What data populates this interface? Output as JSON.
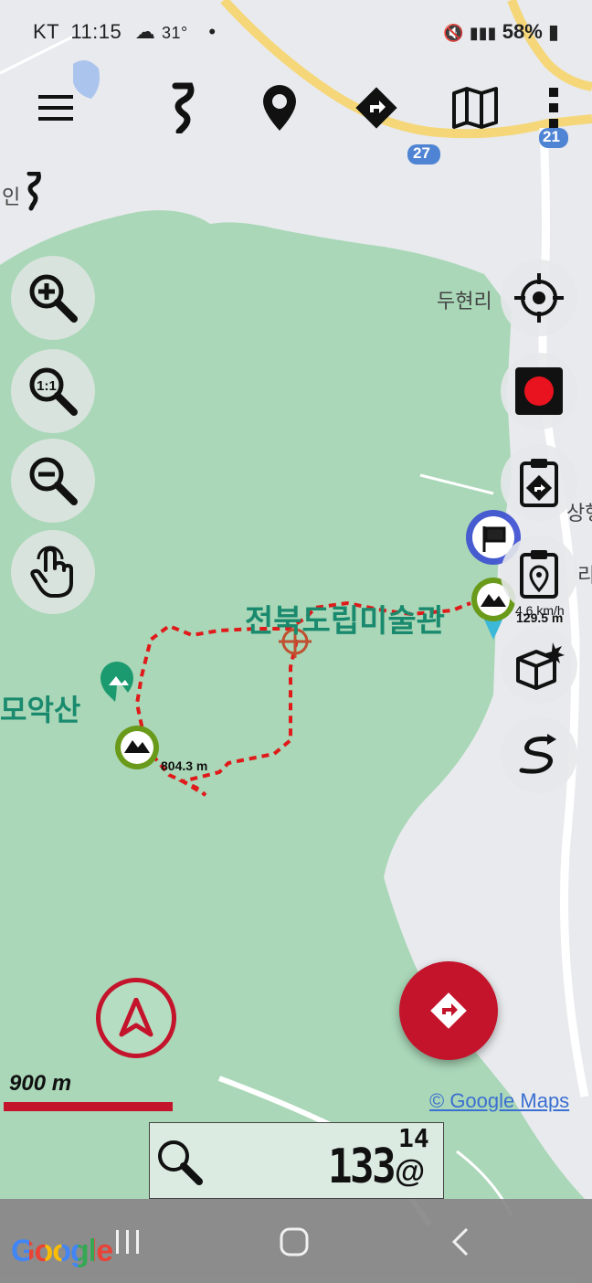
{
  "status_bar": {
    "carrier": "KT",
    "time": "11:15",
    "temperature": "31°",
    "battery": "58%"
  },
  "toolbar": {
    "icons": [
      "menu-icon",
      "track-icon",
      "waypoint-icon",
      "route-icon",
      "map-icon",
      "more-icon"
    ]
  },
  "map_labels": {
    "place_left_edge": "인",
    "village": "두현리",
    "museum": "전북도립미술관",
    "mountain": "모악산",
    "highway_27": "27",
    "highway_21": "21",
    "right_edge_1": "상행",
    "right_edge_2": "리",
    "speed": "4.6 km/h",
    "altitude_end": "129.5 m",
    "altitude_peak": "804.3 m"
  },
  "scale": {
    "label": "900 m"
  },
  "attribution": "© Google Maps",
  "info_panel": {
    "value": "133",
    "superscript": "14",
    "suffix": "@"
  },
  "google_logo": "Google",
  "colors": {
    "accent": "#c4142c",
    "forest": "#a9d7b7",
    "track": "#e01a1a",
    "road": "#f5d77a"
  }
}
